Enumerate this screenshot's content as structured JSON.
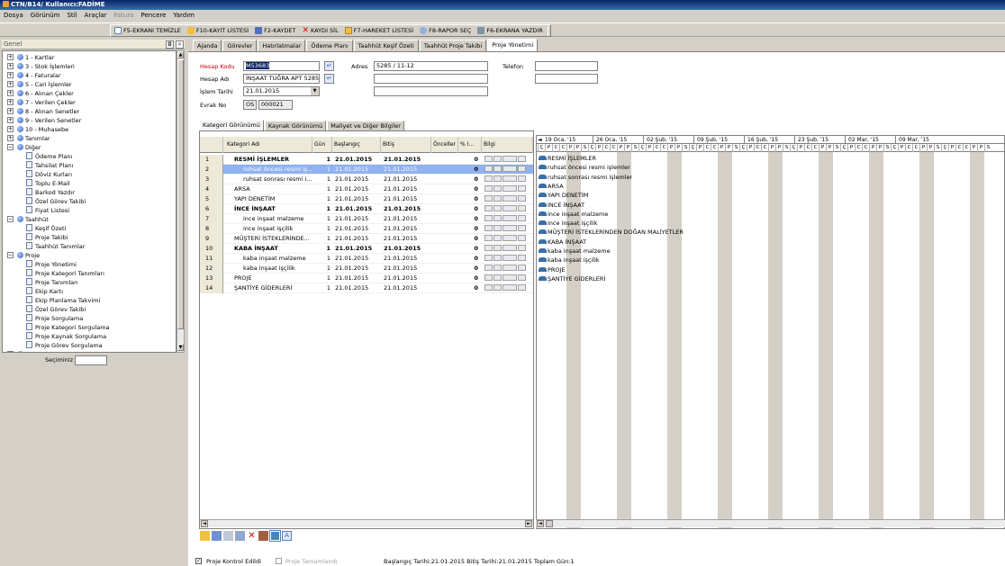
{
  "window": {
    "title": "CTN/B14/ Kullanıcı:FADİME"
  },
  "menu": [
    "Dosya",
    "Görünüm",
    "Stil",
    "Araçlar",
    "Fatura",
    "Pencere",
    "Yardım"
  ],
  "toolbar": {
    "clear_label": "F5-EKRANI TEMİZLE",
    "list_label": "F10-KAYIT LİSTESİ",
    "save_label": "F2-KAYDET",
    "delete_label": "KAYDI SİL",
    "movement_label": "F7-HAREKET LİSTESİ",
    "report_label": "F8-RAPOR SEÇ",
    "print_label": "F6-EKRANA YAZDIR"
  },
  "left_panel": {
    "header": "Genel",
    "selection_label": "Seçiminiz",
    "tree": [
      {
        "label": "1 - Kartlar",
        "type": "group"
      },
      {
        "label": "3 - Stok İşlemleri",
        "type": "group"
      },
      {
        "label": "4 - Faturalar",
        "type": "group"
      },
      {
        "label": "5 - Cari İşlemler",
        "type": "group"
      },
      {
        "label": "6 - Alınan Çekler",
        "type": "group"
      },
      {
        "label": "7 - Verilen Çekler",
        "type": "group"
      },
      {
        "label": "8 - Alınan Senetler",
        "type": "group"
      },
      {
        "label": "9 - Verilen Senetler",
        "type": "group"
      },
      {
        "label": "10 - Muhasebe",
        "type": "group"
      },
      {
        "label": "Tanımlar",
        "type": "group"
      },
      {
        "label": "Diğer",
        "type": "open"
      },
      {
        "label": "Ödeme Planı",
        "type": "leaf"
      },
      {
        "label": "Tahsilat Planı",
        "type": "leaf"
      },
      {
        "label": "Döviz Kurları",
        "type": "leaf"
      },
      {
        "label": "Toplu E-Mail",
        "type": "leaf"
      },
      {
        "label": "Barkod Yazdır",
        "type": "leaf"
      },
      {
        "label": "Özel Görev Takibi",
        "type": "leaf"
      },
      {
        "label": "Fiyat Listesi",
        "type": "leaf"
      },
      {
        "label": "Taahhüt",
        "type": "open"
      },
      {
        "label": "Keşif Özeti",
        "type": "leaf"
      },
      {
        "label": "Proje Takibi",
        "type": "leaf"
      },
      {
        "label": "Taahhüt Tanımlar",
        "type": "leaf"
      },
      {
        "label": "Proje",
        "type": "open"
      },
      {
        "label": "Proje Yönetimi",
        "type": "leaf"
      },
      {
        "label": "Proje Kategori Tanımları",
        "type": "leaf"
      },
      {
        "label": "Proje Tanımları",
        "type": "leaf"
      },
      {
        "label": "Ekip Kartı",
        "type": "leaf"
      },
      {
        "label": "Ekip Planlama Takvimi",
        "type": "leaf"
      },
      {
        "label": "Özel Görev Takibi",
        "type": "leaf"
      },
      {
        "label": "Proje Sorgulama",
        "type": "leaf"
      },
      {
        "label": "Proje Kategori Sorgulama",
        "type": "leaf"
      },
      {
        "label": "Proje Kaynak Sorgulama",
        "type": "leaf"
      },
      {
        "label": "Proje Görev Sorgulama",
        "type": "leaf"
      },
      {
        "label": "Çok Amaçlı Sorgulama",
        "type": "group"
      }
    ]
  },
  "tabs": [
    "Ajanda",
    "Görevler",
    "Hatırlatmalar",
    "Ödeme Planı",
    "Taahhüt Keşif Özeti",
    "Taahhüt Proje Takibi",
    "Proje Yönetimi"
  ],
  "form": {
    "account_code_label": "Hesap Kodu",
    "account_code": "M53683",
    "account_name_label": "Hesap Adı",
    "account_name": "İNŞAAT TUĞRA APT 5285",
    "date_label": "İşlem Tarihi",
    "date": "21.01.2015",
    "doc_no_label": "Evrak No",
    "doc_series": "OS",
    "doc_no": "000021",
    "address_label": "Adres",
    "address": "5285 / 11-12",
    "phone_label": "Telefon"
  },
  "subtabs": [
    "Kategori Görünümü",
    "Kaynak Görünümü",
    "Maliyet ve Diğer Bilgiler"
  ],
  "grid": {
    "columns": [
      "Kategori Adı",
      "Gün",
      "Başlangıç",
      "Bitiş",
      "Önceller",
      "% I...",
      "Bilgi"
    ],
    "rows": [
      {
        "n": "1",
        "name": "RESMİ İŞLEMLER",
        "days": "1",
        "start": "21.01.2015",
        "end": "21.01.2015",
        "pct": "0",
        "bold": true,
        "level": 0
      },
      {
        "n": "2",
        "name": "ruhsat öncesi resmi iş...",
        "days": "1",
        "start": "21.01.2015",
        "end": "21.01.2015",
        "pct": "0",
        "bold": false,
        "level": 1
      },
      {
        "n": "3",
        "name": "ruhsat sonrası resmi i...",
        "days": "1",
        "start": "21.01.2015",
        "end": "21.01.2015",
        "pct": "0",
        "bold": false,
        "level": 1
      },
      {
        "n": "4",
        "name": "ARSA",
        "days": "1",
        "start": "21.01.2015",
        "end": "21.01.2015",
        "pct": "0",
        "bold": false,
        "level": 0
      },
      {
        "n": "5",
        "name": "YAPI DENETİM",
        "days": "1",
        "start": "21.01.2015",
        "end": "21.01.2015",
        "pct": "0",
        "bold": false,
        "level": 0
      },
      {
        "n": "6",
        "name": "İNCE İNŞAAT",
        "days": "1",
        "start": "21.01.2015",
        "end": "21.01.2015",
        "pct": "0",
        "bold": true,
        "level": 0
      },
      {
        "n": "7",
        "name": "ince inşaat malzeme",
        "days": "1",
        "start": "21.01.2015",
        "end": "21.01.2015",
        "pct": "0",
        "bold": false,
        "level": 1
      },
      {
        "n": "8",
        "name": "ince inşaat işçilik",
        "days": "1",
        "start": "21.01.2015",
        "end": "21.01.2015",
        "pct": "0",
        "bold": false,
        "level": 1
      },
      {
        "n": "9",
        "name": "MÜŞTERİ İSTEKLERİNDE...",
        "days": "1",
        "start": "21.01.2015",
        "end": "21.01.2015",
        "pct": "0",
        "bold": false,
        "level": 0
      },
      {
        "n": "10",
        "name": "KABA İNŞAAT",
        "days": "1",
        "start": "21.01.2015",
        "end": "21.01.2015",
        "pct": "0",
        "bold": true,
        "level": 0
      },
      {
        "n": "11",
        "name": "kaba inşaat malzeme",
        "days": "1",
        "start": "21.01.2015",
        "end": "21.01.2015",
        "pct": "0",
        "bold": false,
        "level": 1
      },
      {
        "n": "12",
        "name": "kaba inşaat işçilik",
        "days": "1",
        "start": "21.01.2015",
        "end": "21.01.2015",
        "pct": "0",
        "bold": false,
        "level": 1
      },
      {
        "n": "13",
        "name": "PROJE",
        "days": "1",
        "start": "21.01.2015",
        "end": "21.01.2015",
        "pct": "0",
        "bold": false,
        "level": 0
      },
      {
        "n": "14",
        "name": "ŞANTİYE GİDERLERİ",
        "days": "1",
        "start": "21.01.2015",
        "end": "21.01.2015",
        "pct": "0",
        "bold": false,
        "level": 0
      }
    ]
  },
  "gantt": {
    "weeks": [
      "19 Oca, '15",
      "26 Oca, '15",
      "02 Şub, '15",
      "09 Şub, '15",
      "16 Şub, '15",
      "23 Şub, '15",
      "02 Mar, '15",
      "09 Mar, '15"
    ],
    "day_letters": [
      "Ç",
      "P",
      "C",
      "C",
      "P",
      "P",
      "S",
      "Ç",
      "P",
      "C",
      "C",
      "P",
      "P",
      "S",
      "Ç",
      "P",
      "C",
      "C",
      "P",
      "P",
      "S",
      "Ç",
      "P",
      "C",
      "C",
      "P",
      "P",
      "S",
      "Ç",
      "P",
      "C",
      "C",
      "P",
      "P",
      "S",
      "Ç",
      "P",
      "C",
      "C",
      "P",
      "P",
      "S",
      "Ç",
      "P",
      "C",
      "C",
      "P",
      "P",
      "S",
      "Ç",
      "P",
      "C",
      "C",
      "P",
      "P",
      "S",
      "Ç",
      "P",
      "C",
      "C",
      "P",
      "P",
      "S"
    ],
    "tasks": [
      "RESMİ İŞLEMLER",
      "ruhsat öncesi resmi işlemler",
      "ruhsat sonrası resmi işlemler",
      "ARSA",
      "YAPI DENETİM",
      "İNCE İNŞAAT",
      "ince inşaat malzeme",
      "ince inşaat işçilik",
      "MÜŞTERİ İSTEKLERİNDEN DOĞAN MALİYETLER",
      "KABA İNŞAAT",
      "kaba inşaat malzeme",
      "kaba inşaat işçilik",
      "PROJE",
      "ŞANTİYE GİDERLERİ"
    ]
  },
  "footer": {
    "project_control_label": "Proje Kontrol Edildi",
    "project_done_label": "Proje Tamamlandı",
    "summary": "Başlangıç Tarihi:21.01.2015 Bitiş Tarihi:21.01.2015 Toplam Gün:1"
  },
  "colors": {
    "title_bar": "#0a246a",
    "selected_row": "#8fb2f0",
    "weekend": "#d4d0c8",
    "label_red": "#c00000"
  }
}
